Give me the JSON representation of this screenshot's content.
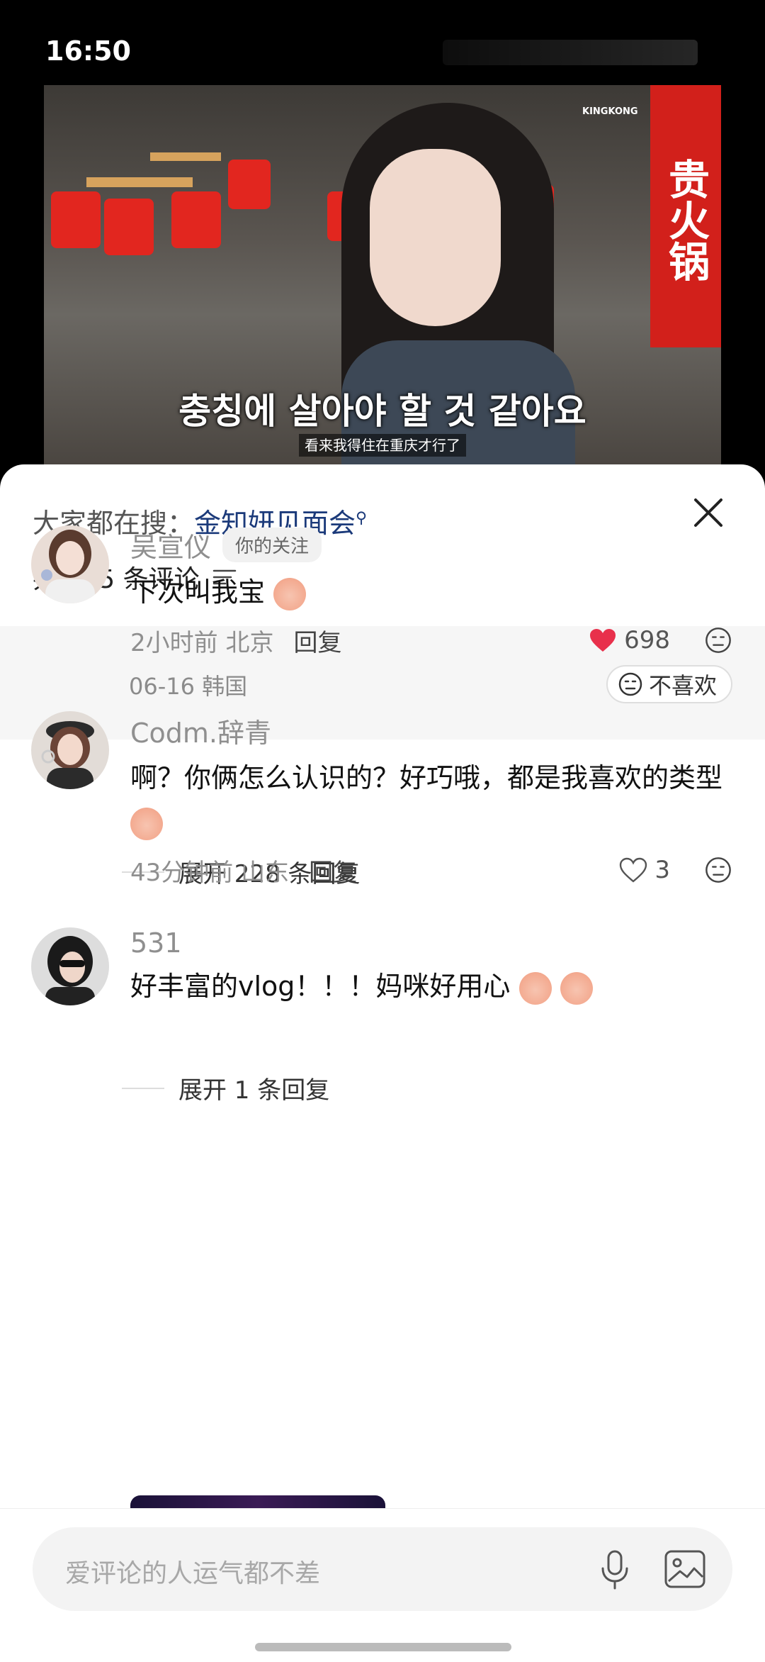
{
  "status": {
    "time": "16:50"
  },
  "video": {
    "subtitle_ko": "충칭에 살아야 할 것 같아요",
    "subtitle_zh": "看来我得住在重庆才行了",
    "brand": "KINGKONG",
    "sign_text": "贵火锅"
  },
  "sheet": {
    "search_prefix": "大家都在搜：",
    "search_term": "金知妍见面会",
    "comment_count": "共 315 条评论"
  },
  "pinned": {
    "meta": "06-16 韩国",
    "dislike_label": "不喜欢"
  },
  "comments": [
    {
      "name": "吴宣仪",
      "tag": "你的关注",
      "text": "下次叫我宝",
      "time": "2小时前 北京",
      "reply": "回复",
      "likes": "698",
      "liked": true,
      "expand": "展开 228 条回复"
    },
    {
      "name": "Codm.辞青",
      "text": "啊？你俩怎么认识的？好巧哦，都是我喜欢的类型",
      "time": "43分钟前 山东",
      "reply": "回复",
      "likes": "3",
      "liked": false,
      "expand": "展开 1 条回复"
    },
    {
      "name": "531",
      "text": "好丰富的vlog！！！妈咪好用心"
    }
  ],
  "input": {
    "placeholder": "爱评论的人运气都不差"
  },
  "colors": {
    "like_red": "#e8304b",
    "link_blue": "#1b3a7a"
  }
}
